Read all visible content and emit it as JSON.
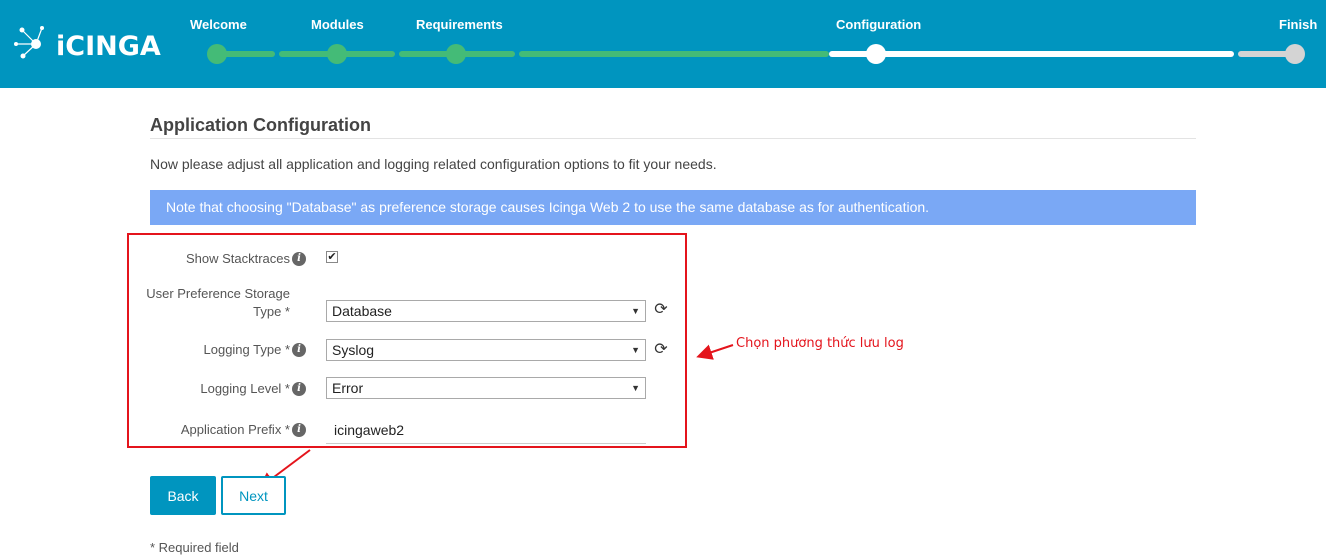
{
  "header": {
    "logo_text": "iCINGA",
    "steps": [
      {
        "label": "Welcome",
        "state": "done"
      },
      {
        "label": "Modules",
        "state": "done"
      },
      {
        "label": "Requirements",
        "state": "done"
      },
      {
        "label": "Configuration",
        "state": "current"
      },
      {
        "label": "Finish",
        "state": "pending"
      }
    ],
    "colors": {
      "header": "#0095bf",
      "done": "#44bb77",
      "current": "#ffffff",
      "pending": "#d4d4d4"
    }
  },
  "page": {
    "title": "Application Configuration",
    "intro": "Now please adjust all application and logging related configuration options to fit your needs.",
    "note": "Note that choosing \"Database\" as preference storage causes Icinga Web 2 to use the same database as for authentication."
  },
  "form": {
    "show_stacktraces": {
      "label": "Show Stacktraces",
      "checked": true
    },
    "preference_storage": {
      "label_line1": "User Preference Storage",
      "label_line2": "Type *",
      "value": "Database"
    },
    "logging_type": {
      "label": "Logging Type *",
      "value": "Syslog"
    },
    "logging_level": {
      "label": "Logging Level *",
      "value": "Error"
    },
    "application_prefix": {
      "label": "Application Prefix *",
      "value": "icingaweb2"
    }
  },
  "buttons": {
    "back": "Back",
    "next": "Next"
  },
  "footer": {
    "required_note": "* Required field"
  },
  "annotation": {
    "text": "Chọn phương thức lưu log",
    "color": "#e4141c"
  },
  "icons": {
    "info": "info-icon",
    "reload": "reload-icon",
    "dropdown": "caret-down-icon",
    "check": "check-icon"
  }
}
